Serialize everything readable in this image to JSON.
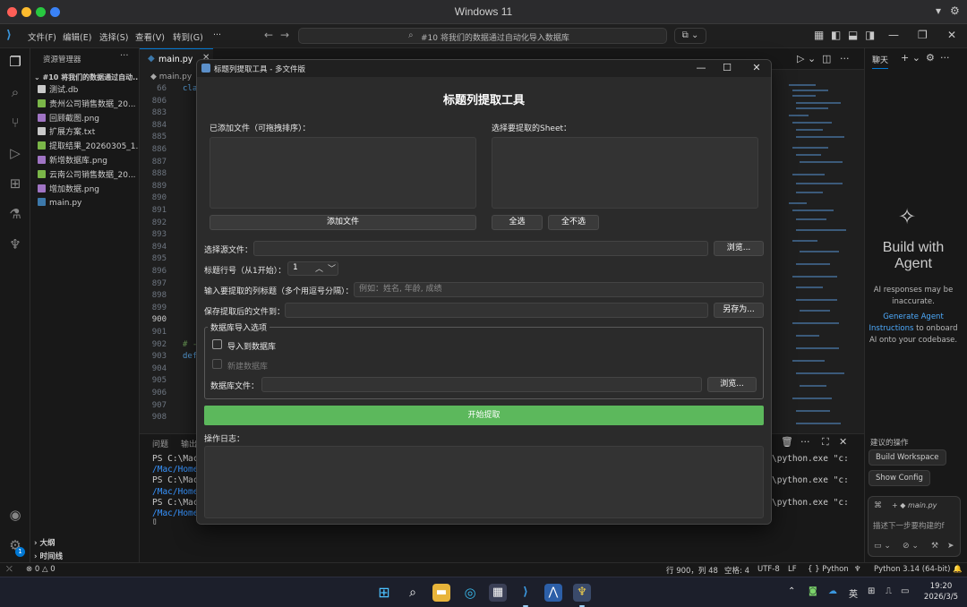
{
  "mac": {
    "title": "Windows 11"
  },
  "vscode": {
    "menu": [
      "文件(F)",
      "编辑(E)",
      "选择(S)",
      "查看(V)",
      "转到(G)",
      "···"
    ],
    "command_center": "#10 将我们的数据通过自动化导入数据库"
  },
  "explorer": {
    "title": "资源管理器",
    "folder": "#10 将我们的数据通过自动...",
    "files": [
      {
        "name": "测试.db",
        "color": "#c9c9c9"
      },
      {
        "name": "贵州公司销售数据_20...",
        "color": "#7ab648"
      },
      {
        "name": "回顾截图.png",
        "color": "#a074c4"
      },
      {
        "name": "扩展方案.txt",
        "color": "#c9c9c9"
      },
      {
        "name": "提取结果_20260305_1...",
        "color": "#7ab648"
      },
      {
        "name": "新增数据库.png",
        "color": "#a074c4"
      },
      {
        "name": "云南公司销售数据_20...",
        "color": "#7ab648"
      },
      {
        "name": "增加数据.png",
        "color": "#a074c4"
      },
      {
        "name": "main.py",
        "color": "#3c78aa"
      }
    ],
    "outline": "大纲",
    "timeline": "时间线",
    "notification_count": "1"
  },
  "editor": {
    "tab": "main.py",
    "breadcrumb": "main.py",
    "lines": [
      {
        "num": "66",
        "code": "cla"
      },
      {
        "num": "806",
        "code": ""
      },
      {
        "num": "883",
        "code": ""
      },
      {
        "num": "884",
        "code": ""
      },
      {
        "num": "885",
        "code": ""
      },
      {
        "num": "886",
        "code": ""
      },
      {
        "num": "887",
        "code": ""
      },
      {
        "num": "888",
        "code": ""
      },
      {
        "num": "889",
        "code": ""
      },
      {
        "num": "890",
        "code": ""
      },
      {
        "num": "891",
        "code": ""
      },
      {
        "num": "892",
        "code": ""
      },
      {
        "num": "893",
        "code": ""
      },
      {
        "num": "894",
        "code": ""
      },
      {
        "num": "895",
        "code": ""
      },
      {
        "num": "896",
        "code": ""
      },
      {
        "num": "897",
        "code": ""
      },
      {
        "num": "898",
        "code": ""
      },
      {
        "num": "899",
        "code": ""
      },
      {
        "num": "900",
        "code": ""
      },
      {
        "num": "901",
        "code": ""
      },
      {
        "num": "902",
        "code": "# -"
      },
      {
        "num": "903",
        "code": "def"
      },
      {
        "num": "904",
        "code": ""
      },
      {
        "num": "905",
        "code": ""
      },
      {
        "num": "906",
        "code": ""
      },
      {
        "num": "907",
        "code": ""
      },
      {
        "num": "908",
        "code": ""
      }
    ]
  },
  "panel": {
    "tabs": [
      "问题",
      "输出"
    ],
    "terminal": [
      {
        "left": "PS C:\\Mac",
        "right": "\\python.exe \"c:"
      },
      {
        "left": "/Mac/Home",
        "right": ""
      },
      {
        "left": "PS C:\\Mac",
        "right": "\\python.exe \"c:"
      },
      {
        "left": "/Mac/Home",
        "right": ""
      },
      {
        "left": "PS C:\\Mac",
        "right": "\\python.exe \"c:"
      },
      {
        "left": "/Mac/Home",
        "right": ""
      }
    ]
  },
  "chat": {
    "tab": "聊天",
    "heading": "Build with Agent",
    "disclaimer": "AI responses may be inaccurate.",
    "link": "Generate Agent Instructions",
    "link_tail": "to onboard AI onto your codebase.",
    "suggested_title": "建议的操作",
    "suggestions": [
      "Build Workspace",
      "Show Config"
    ],
    "context_file": "main.py",
    "input_placeholder": "描述下一步要构建的f"
  },
  "status": {
    "errors": "0",
    "warnings": "0",
    "cursor": "行 900，列 48",
    "spaces": "空格: 4",
    "encoding": "UTF-8",
    "eol": "LF",
    "language": "Python",
    "interpreter": "Python 3.14 (64-bit)"
  },
  "taskbar": {
    "ime": "英",
    "time": "19:20",
    "date": "2026/3/5"
  },
  "dialog": {
    "window_title": "标题列提取工具 - 多文件版",
    "heading": "标题列提取工具",
    "files_label": "已添加文件（可拖拽排序）：",
    "sheet_label": "选择要提取的Sheet：",
    "add_file": "添加文件",
    "select_all": "全选",
    "select_none": "全不选",
    "source_label": "选择源文件：",
    "browse": "浏览...",
    "title_row_label": "标题行号（从1开始）：",
    "title_row_value": "1",
    "columns_label": "输入要提取的列标题（多个用逗号分隔）：",
    "columns_placeholder": "例如：姓名, 年龄, 成绩",
    "save_label": "保存提取后的文件到：",
    "save_as": "另存为...",
    "db_group": "数据库导入选项",
    "import_db": "导入到数据库",
    "new_db": "新建数据库",
    "db_file_label": "数据库文件：",
    "db_browse": "浏览...",
    "start": "开始提取",
    "log_label": "操作日志："
  }
}
